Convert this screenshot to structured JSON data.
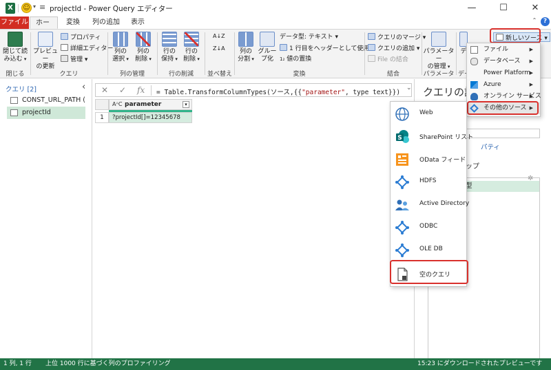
{
  "window": {
    "title": "projectId - Power Query エディター",
    "qat_logo": "X",
    "min_icon": "—",
    "max_icon": "☐",
    "close_icon": "✕"
  },
  "tabs": [
    {
      "label": "ファイル"
    },
    {
      "label": "ホーム"
    },
    {
      "label": "変換"
    },
    {
      "label": "列の追加"
    },
    {
      "label": "表示"
    }
  ],
  "ribbon": {
    "close_load": "閉じて読\nみ込む",
    "preview_refresh": "プレビュー\nの更新",
    "properties": "プロパティ",
    "advanced_editor": "詳細エディター",
    "manage": "管理",
    "choose_columns": "列の\n選択",
    "remove_columns": "列の\n削除",
    "keep_rows": "行の\n保持",
    "remove_rows": "行の\n削除",
    "sort_asc": "A↓Z",
    "sort_desc": "Z↓A",
    "split_column": "列の\n分割",
    "group_by": "グルー\nプ化",
    "data_type": "データ型: テキスト",
    "first_row_header": "1 行目をヘッダーとして使用",
    "replace_values": "値の置換",
    "merge_queries": "クエリのマージ",
    "append_queries": "クエリの追加",
    "combine_files": "File の結合",
    "manage_parameters": "パラメーター\nの管理",
    "data_source_partial": "デ",
    "new_source": "新しいソース",
    "groups": {
      "close": "閉じる",
      "query": "クエリ",
      "manage_columns": "列の管理",
      "reduce_rows": "行の削減",
      "sort": "並べ替え",
      "transform": "変換",
      "combine": "結合",
      "parameters": "パラメーター",
      "data_partial": "デー"
    },
    "help_icon": "?"
  },
  "queries": {
    "header": "クエリ [2]",
    "items": [
      {
        "name": "CONST_URL_PATH (h..."
      },
      {
        "name": "projectId"
      }
    ]
  },
  "formula": {
    "text_prefix": "= Table.TransformColumnTypes(ソース,{{",
    "text_string": "\"parameter\"",
    "text_suffix": ", type text}})",
    "fx": "fx"
  },
  "table": {
    "column_type": "AᴬC",
    "column_header": "parameter",
    "rows": [
      {
        "num": "1",
        "value": "?projectId[]=12345678"
      }
    ]
  },
  "settings": {
    "title": "クエリの設",
    "properties_partial": "パティ",
    "steps_partial": "ップ",
    "step_partial": "型"
  },
  "new_source_menu": [
    {
      "label": "ファイル"
    },
    {
      "label": "データベース"
    },
    {
      "label": "Power Platform"
    },
    {
      "label": "Azure"
    },
    {
      "label": "オンライン サービス"
    },
    {
      "label": "その他のソース"
    }
  ],
  "other_sources_menu": [
    {
      "label": "Web"
    },
    {
      "label": "SharePoint リスト"
    },
    {
      "label": "OData フィード"
    },
    {
      "label": "HDFS"
    },
    {
      "label": "Active Directory"
    },
    {
      "label": "ODBC"
    },
    {
      "label": "OLE DB"
    },
    {
      "label": "空のクエリ"
    }
  ],
  "statusbar": {
    "position": "1 列, 1 行",
    "profiling": "上位 1000 行に基づく列のプロファイリング",
    "download": "15:23 にダウンロードされたプレビューです"
  },
  "colors": {
    "accent_green": "#217346",
    "file_tab_red": "#d22d22",
    "highlight_red": "#d9302c",
    "selection_green": "#d5ecdf"
  }
}
